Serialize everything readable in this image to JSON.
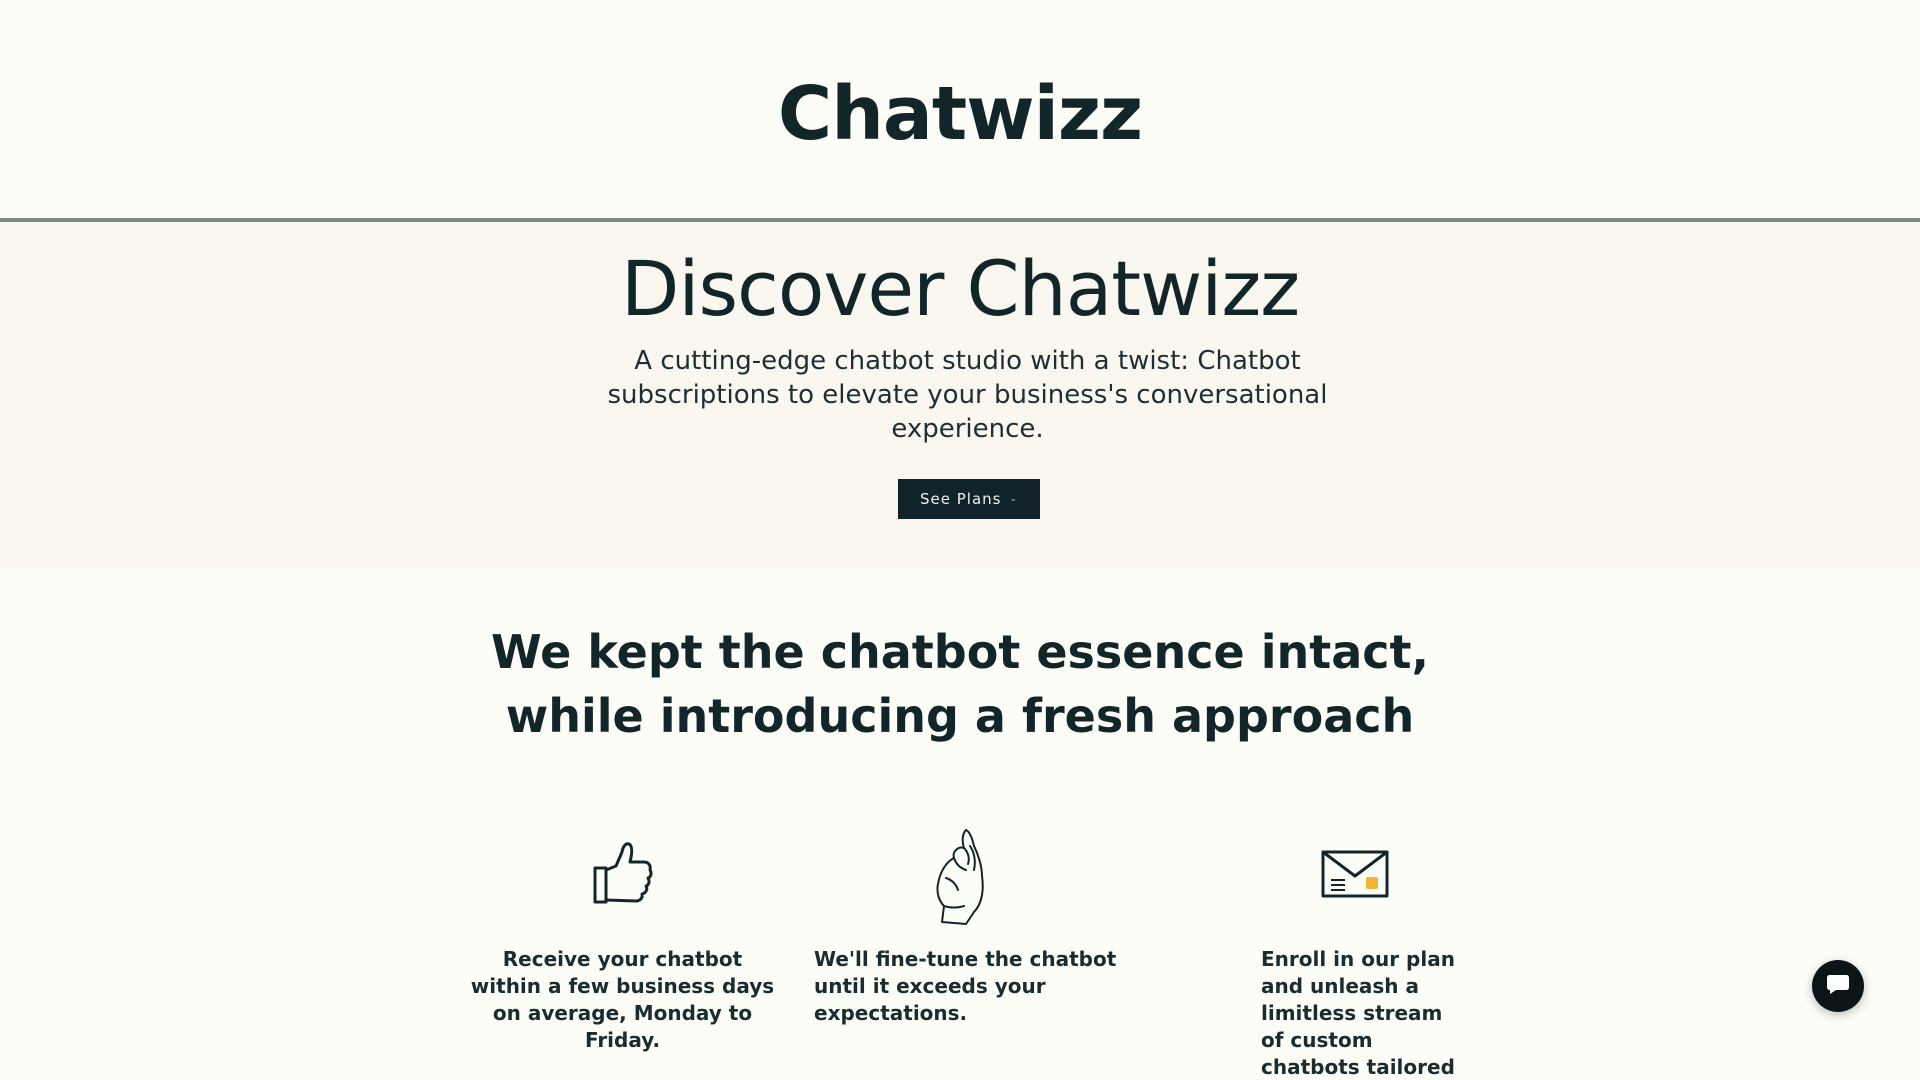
{
  "header": {
    "logo_text": "Chatwizz"
  },
  "hero": {
    "title": "Discover Chatwizz",
    "subtitle": "A cutting-edge chatbot studio with a twist: Chatbot subscriptions to elevate your business's conversational experience.",
    "cta_label": "See Plans",
    "cta_icon": "chevron-down-icon"
  },
  "features": {
    "title_line1": "We kept the chatbot essence intact,",
    "title_line2": "while introducing a fresh approach",
    "items": [
      {
        "icon": "thumbs-up-icon",
        "text": "Receive your chatbot within a few business days on average, Monday to Friday."
      },
      {
        "icon": "hand-gesture-icon",
        "text": "We'll fine-tune the chatbot until it exceeds your expectations."
      },
      {
        "icon": "envelope-icon",
        "text": "Enroll in our plan and unleash a limitless stream of custom chatbots tailored"
      }
    ]
  },
  "chat_widget": {
    "icon": "chat-bubble-icon"
  },
  "colors": {
    "text_dark": "#12262a",
    "hero_bg": "#f9f7ef",
    "page_bg": "#fdfdf8",
    "button_bg": "#0f2328",
    "accent_yellow": "#f2b632"
  }
}
